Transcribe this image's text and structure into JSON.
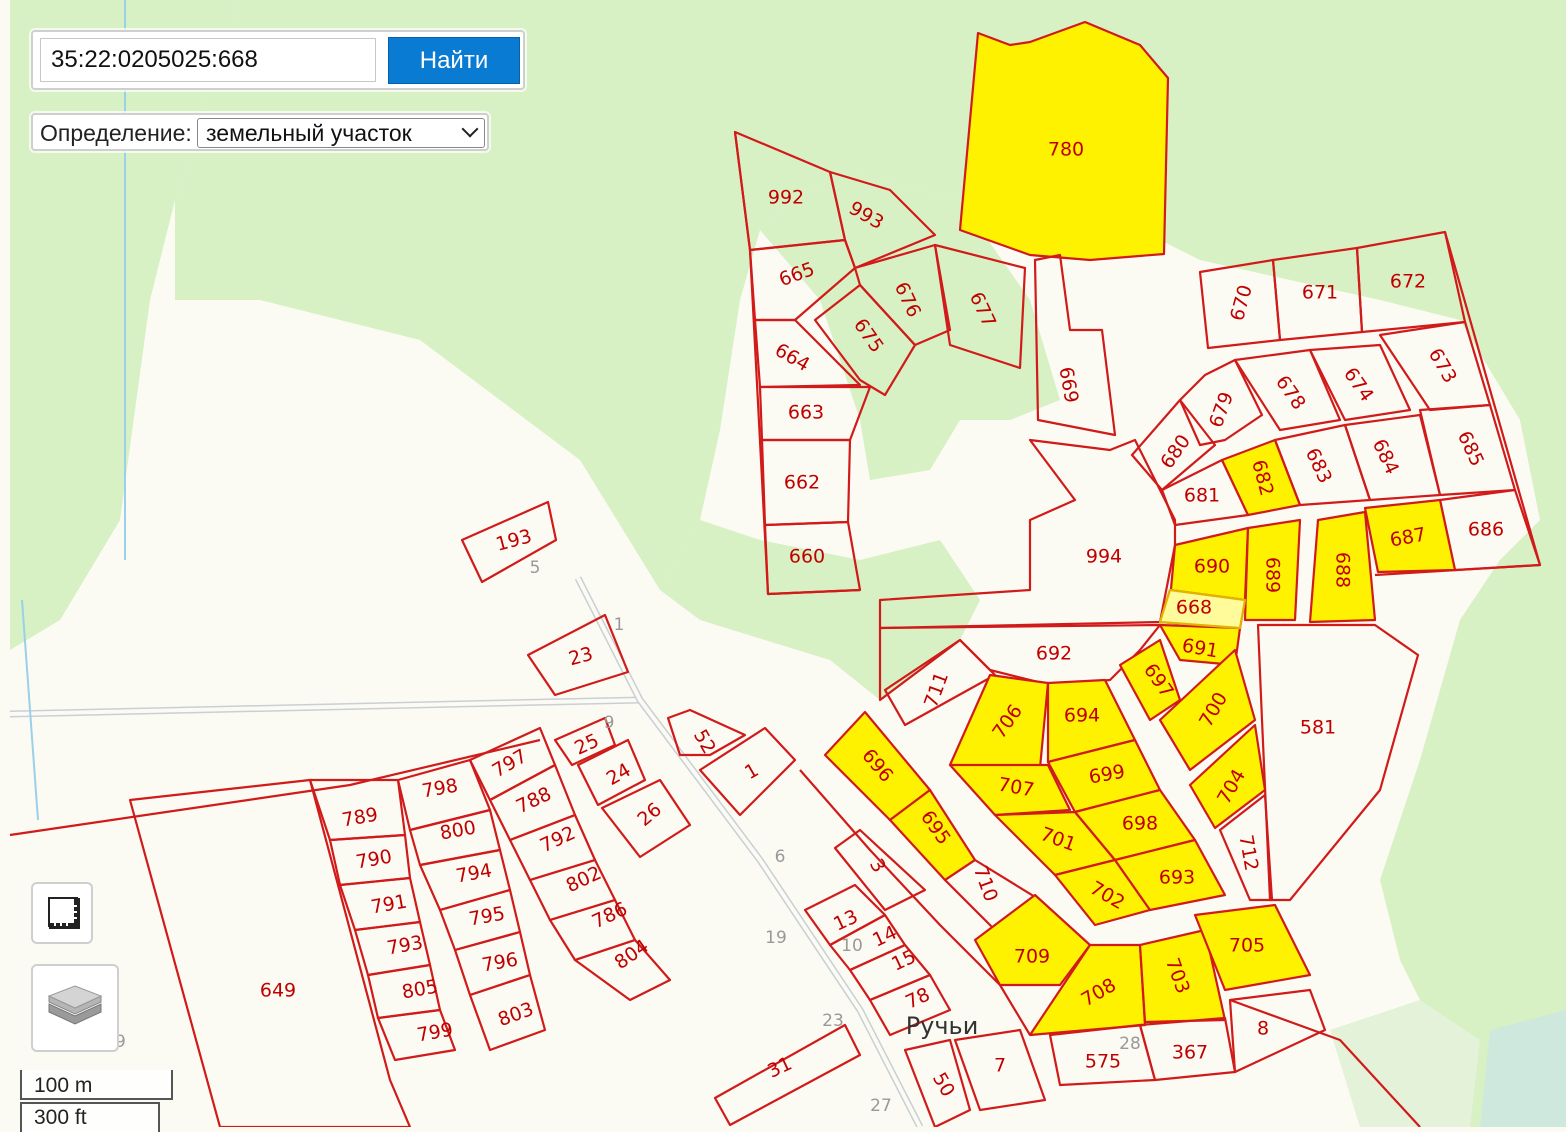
{
  "search": {
    "value": "35:22:0205025:668",
    "button_label": "Найти"
  },
  "identify": {
    "label": "Определение:",
    "selected": "земельный участок"
  },
  "scale": {
    "metric": "100 m",
    "imperial": "300 ft"
  },
  "place_name": "Ручьи",
  "selected_parcel": "668",
  "highlight_color": "#fff200",
  "boundary_color": "#d11a1a",
  "parcels": [
    "780",
    "992",
    "993",
    "665",
    "676",
    "677",
    "675",
    "664",
    "663",
    "662",
    "660",
    "669",
    "670",
    "671",
    "672",
    "673",
    "679",
    "678",
    "674",
    "680",
    "681",
    "682",
    "683",
    "684",
    "685",
    "686",
    "687",
    "690",
    "689",
    "688",
    "994",
    "668",
    "691",
    "692",
    "711",
    "706",
    "694",
    "697",
    "700",
    "581",
    "696",
    "707",
    "699",
    "695",
    "701",
    "698",
    "704",
    "712",
    "702",
    "693",
    "710",
    "709",
    "708",
    "703",
    "705",
    "8",
    "367",
    "575",
    "193",
    "23",
    "25",
    "24",
    "26",
    "52",
    "1",
    "797",
    "798",
    "789",
    "788",
    "800",
    "790",
    "792",
    "794",
    "791",
    "802",
    "795",
    "786",
    "793",
    "796",
    "804",
    "805",
    "803",
    "799",
    "649",
    "3",
    "13",
    "14",
    "15",
    "78",
    "31",
    "50",
    "7"
  ],
  "highlighted_parcels": [
    "780",
    "682",
    "690",
    "689",
    "688",
    "687",
    "668",
    "691",
    "697",
    "700",
    "706",
    "694",
    "696",
    "707",
    "699",
    "695",
    "701",
    "698",
    "704",
    "702",
    "693",
    "709",
    "708",
    "703",
    "705"
  ],
  "block_numbers": [
    "5",
    "1",
    "9",
    "6",
    "19",
    "10",
    "23",
    "27",
    "28",
    "29"
  ],
  "icons": {
    "measure": "ruler-icon",
    "layers": "layers-icon"
  }
}
